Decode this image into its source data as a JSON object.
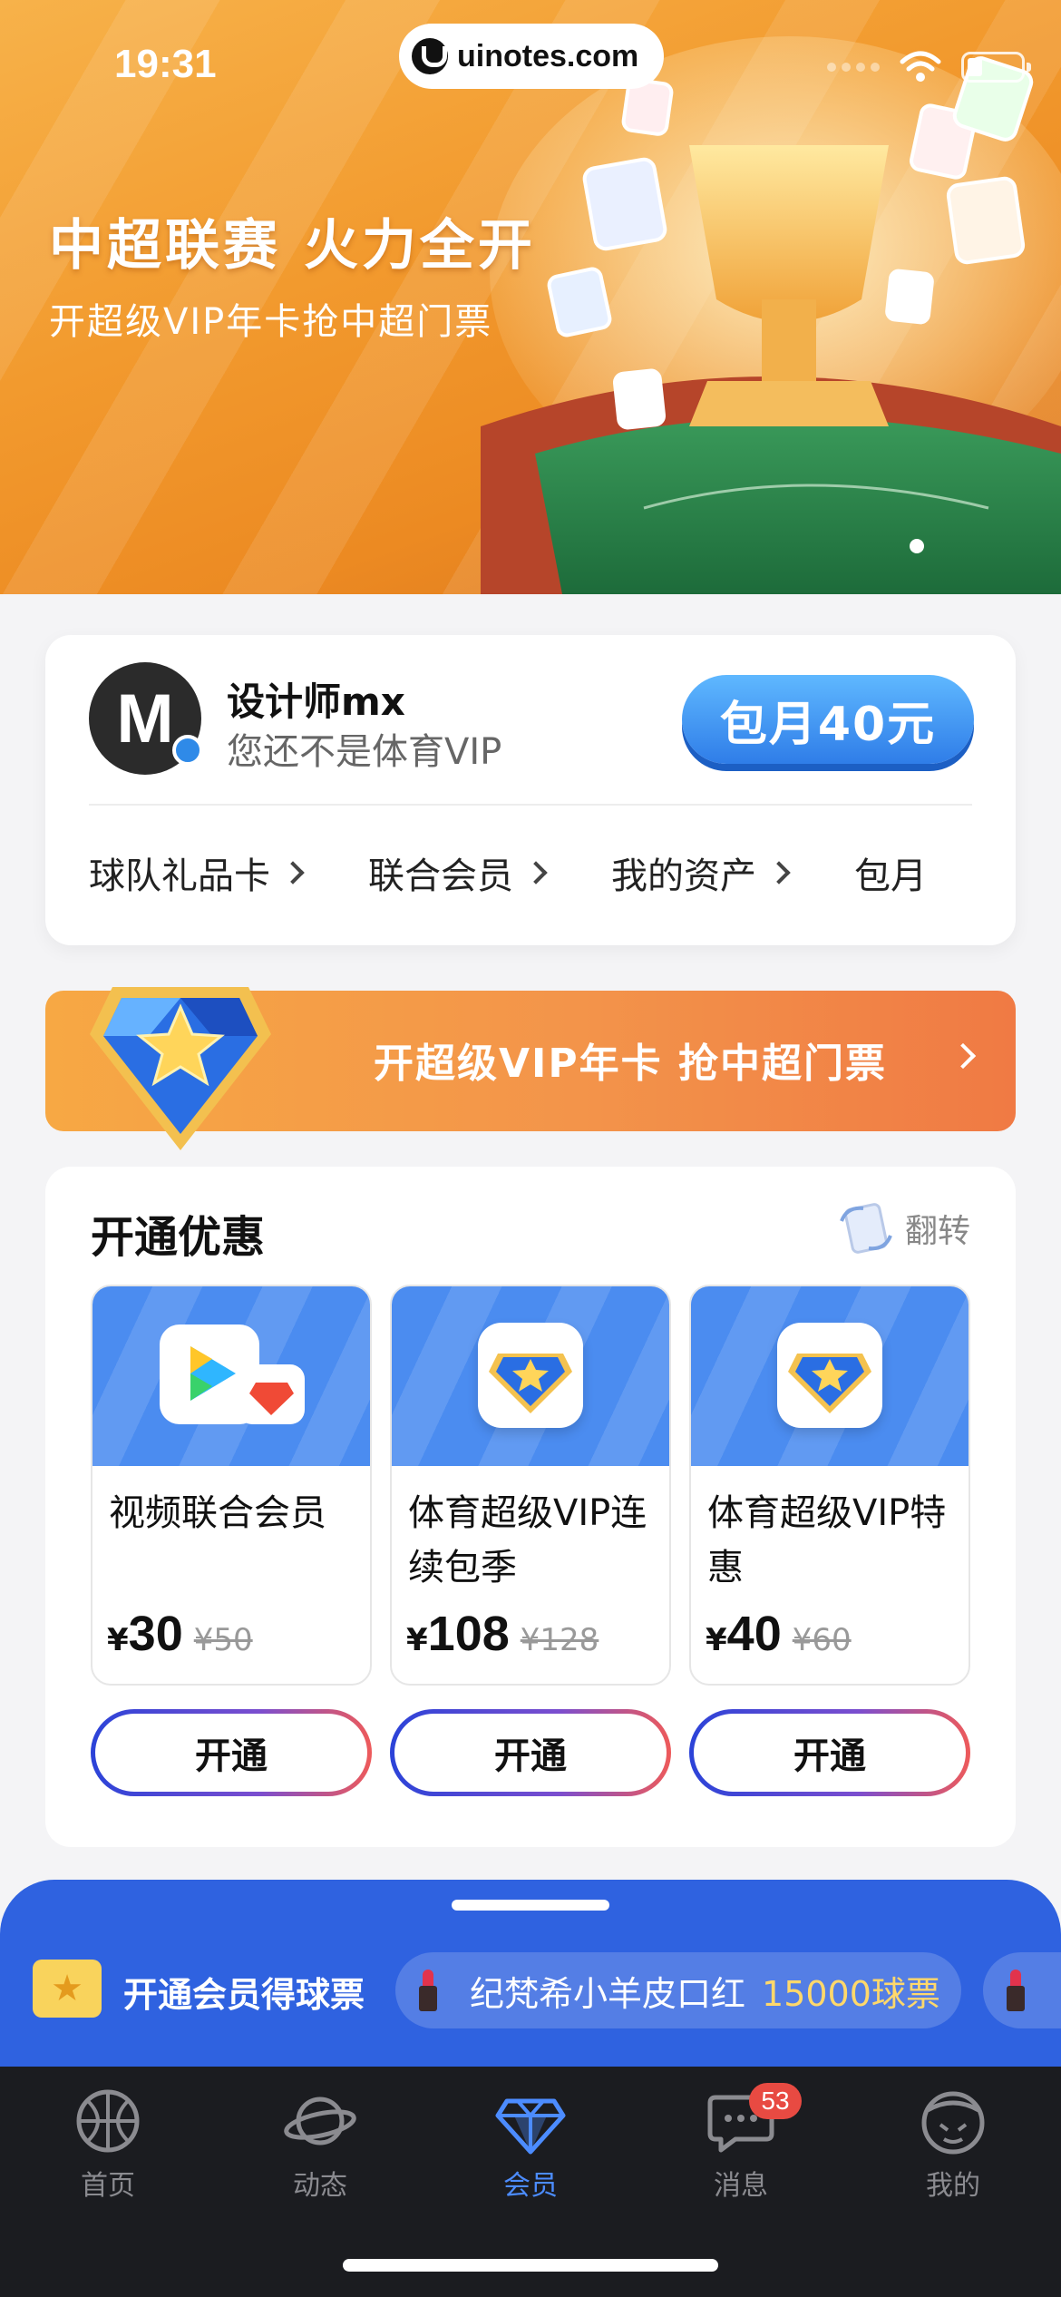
{
  "status_bar": {
    "time": "19:31",
    "url": "uinotes.com"
  },
  "hero": {
    "title": "中超联赛 火力全开",
    "subtitle": "开超级VIP年卡抢中超门票"
  },
  "user": {
    "avatar_letter": "M",
    "name": "设计师mx",
    "status": "您还不是体育VIP",
    "monthly_button": "包月40元"
  },
  "quick_links": [
    {
      "label": "球队礼品卡"
    },
    {
      "label": "联合会员"
    },
    {
      "label": "我的资产"
    },
    {
      "label": "包月"
    }
  ],
  "promo": {
    "text": "开超级VIP年卡 抢中超门票"
  },
  "offers": {
    "title": "开通优惠",
    "flip_label": "翻转",
    "items": [
      {
        "name": "视频联合会员",
        "yen": "¥",
        "price": "30",
        "original": "¥50",
        "button": "开通"
      },
      {
        "name": "体育超级VIP连续包季",
        "yen": "¥",
        "price": "108",
        "original": "¥128",
        "button": "开通"
      },
      {
        "name": "体育超级VIP特惠",
        "yen": "¥",
        "price": "40",
        "original": "¥60",
        "button": "开通"
      }
    ]
  },
  "tickets": {
    "label": "开通会员得球票",
    "reward_name": "纪梵希小羊皮口红",
    "reward_points": "15000球票"
  },
  "tabbar": {
    "items": [
      {
        "label": "首页",
        "icon": "basketball-icon"
      },
      {
        "label": "动态",
        "icon": "planet-icon"
      },
      {
        "label": "会员",
        "icon": "diamond-icon"
      },
      {
        "label": "消息",
        "icon": "chat-icon"
      },
      {
        "label": "我的",
        "icon": "profile-icon"
      }
    ],
    "message_badge": "53"
  },
  "colors": {
    "accent_blue": "#2f62e0",
    "hero_orange": "#f29a2e",
    "active_tab": "#4c8cff",
    "badge_red": "#e84a42"
  }
}
